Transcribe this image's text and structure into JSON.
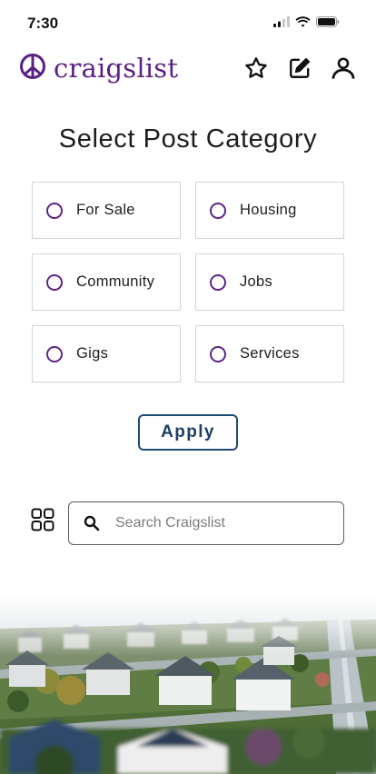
{
  "status_bar": {
    "time": "7:30"
  },
  "header": {
    "logo_text": "craigslist",
    "logo_icon": "peace-sign-icon",
    "actions": [
      {
        "name": "favorites",
        "icon": "star-icon"
      },
      {
        "name": "compose",
        "icon": "edit-icon"
      },
      {
        "name": "account",
        "icon": "user-icon"
      }
    ]
  },
  "page_title": "Select Post Category",
  "categories": [
    {
      "label": "For Sale"
    },
    {
      "label": "Housing"
    },
    {
      "label": "Community"
    },
    {
      "label": "Jobs"
    },
    {
      "label": "Gigs"
    },
    {
      "label": "Services"
    }
  ],
  "apply_label": "Apply",
  "search": {
    "placeholder": "Search Craigslist",
    "value": ""
  },
  "colors": {
    "brand_purple": "#5b1f85",
    "apply_navy": "#1e4a78",
    "card_border": "#cfd6dc"
  },
  "illustration": "aerial-suburban-neighborhood"
}
